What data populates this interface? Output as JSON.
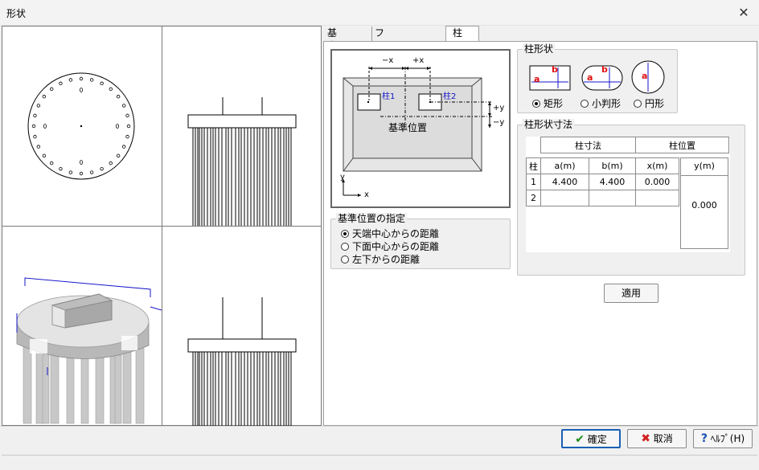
{
  "window": {
    "title": "形状",
    "close_glyph": "✕"
  },
  "tabs": [
    {
      "label": "基本条件",
      "active": false
    },
    {
      "label": "フーチング形状",
      "active": false
    },
    {
      "label": "柱",
      "active": true
    }
  ],
  "diagram": {
    "minus_x": "−x",
    "plus_x": "+x",
    "col1": "柱1",
    "col2": "柱2",
    "plus_y": "+y",
    "minus_y": "−y",
    "ref_label": "基準位置",
    "axis_y": "y",
    "axis_x": "x"
  },
  "ref_position": {
    "title": "基準位置の指定",
    "options": [
      {
        "label": "天端中心からの距離",
        "selected": true
      },
      {
        "label": "下面中心からの距離",
        "selected": false
      },
      {
        "label": "左下からの距離",
        "selected": false
      }
    ]
  },
  "column_shape": {
    "title": "柱形状",
    "label_a": "a",
    "label_b": "b",
    "options": [
      {
        "label": "矩形",
        "selected": true
      },
      {
        "label": "小判形",
        "selected": false
      },
      {
        "label": "円形",
        "selected": false
      }
    ]
  },
  "dimensions": {
    "title": "柱形状寸法",
    "group_size": "柱寸法",
    "group_position": "柱位置",
    "headers": [
      "柱",
      "a(m)",
      "b(m)",
      "x(m)",
      "y(m)"
    ],
    "rows": [
      {
        "no": "1",
        "a": "4.400",
        "b": "4.400",
        "x": "0.000"
      },
      {
        "no": "2",
        "a": "",
        "b": "",
        "x": ""
      }
    ],
    "y_value": "0.000"
  },
  "buttons": {
    "apply": "適用",
    "ok": "確定",
    "cancel": "取消",
    "help": "ﾍﾙﾌﾟ(H)"
  },
  "colors": {
    "accent_blue": "#1414c8",
    "label_red": "#e01010",
    "ok_green": "#1a8a1a",
    "cancel_red": "#d02020"
  }
}
